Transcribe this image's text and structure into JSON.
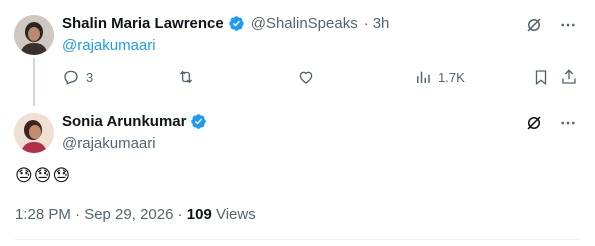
{
  "reply_tweet": {
    "author_name": "Shalin Maria Lawrence",
    "handle": "@ShalinSpeaks",
    "separator": "·",
    "time": "3h",
    "reply_to": "@rajakumaari",
    "stats": {
      "replies": "3",
      "views": "1.7K"
    }
  },
  "main_tweet": {
    "author_name": "Sonia Arunkumar",
    "handle": "@rajakumaari",
    "text": "😓😓😓",
    "timestamp": "1:28 PM · Sep 29, 2026",
    "meta_sep": "·",
    "views_count": "109",
    "views_label": "Views"
  },
  "colors": {
    "verified": "#1d9bf0",
    "muted": "#536471",
    "link": "#1d9bf0"
  },
  "icons": [
    "verified-badge-icon",
    "grok-icon",
    "more-icon",
    "reply-icon",
    "retweet-icon",
    "like-icon",
    "views-icon",
    "bookmark-icon",
    "share-icon"
  ]
}
